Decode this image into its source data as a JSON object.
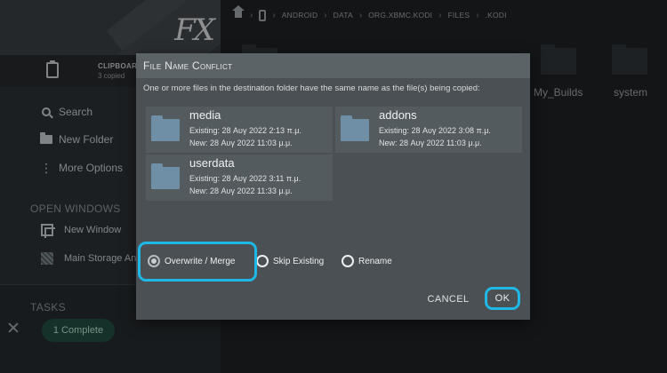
{
  "sidebar": {
    "clipboard": {
      "title": "CLIPBOARD",
      "subtitle": "3 copied"
    },
    "actions": [
      {
        "label": "Search",
        "icon": "search-icon"
      },
      {
        "label": "New Folder",
        "icon": "folder-icon"
      },
      {
        "label": "More Options",
        "icon": "more-vertical-icon"
      }
    ],
    "open_windows_heading": "OPEN WINDOWS",
    "windows": [
      {
        "label": "New Window",
        "icon": "new-window-icon"
      },
      {
        "label": "Main Storage An",
        "icon": "storage-icon"
      }
    ],
    "tasks_heading": "TASKS",
    "task_pill": "1 Complete",
    "logo_text": "FX"
  },
  "breadcrumb": [
    "Android",
    "data",
    "org.xbmc.kodi",
    "files",
    ".kodi"
  ],
  "background_files": [
    "My_Builds",
    "system"
  ],
  "dialog": {
    "title": "File Name Conflict",
    "message": "One or more files in the destination folder have the same name as the file(s) being copied:",
    "conflicts": [
      {
        "name": "media",
        "existing": "Existing: 28 Αυγ 2022 2:13 π.μ.",
        "new": "New: 28 Αυγ 2022 11:03 μ.μ."
      },
      {
        "name": "addons",
        "existing": "Existing: 28 Αυγ 2022 3:08 π.μ.",
        "new": "New: 28 Αυγ 2022 11:03 μ.μ."
      },
      {
        "name": "userdata",
        "existing": "Existing: 28 Αυγ 2022 3:11 π.μ.",
        "new": "New: 28 Αυγ 2022 11:33 μ.μ."
      }
    ],
    "options": [
      {
        "label": "Overwrite / Merge",
        "selected": true
      },
      {
        "label": "Skip Existing",
        "selected": false
      },
      {
        "label": "Rename",
        "selected": false
      }
    ],
    "cancel_label": "CANCEL",
    "ok_label": "OK"
  },
  "colors": {
    "highlight": "#1fb8e6",
    "folder": "#6f8fa6",
    "task_pill": "#1f4d40"
  }
}
